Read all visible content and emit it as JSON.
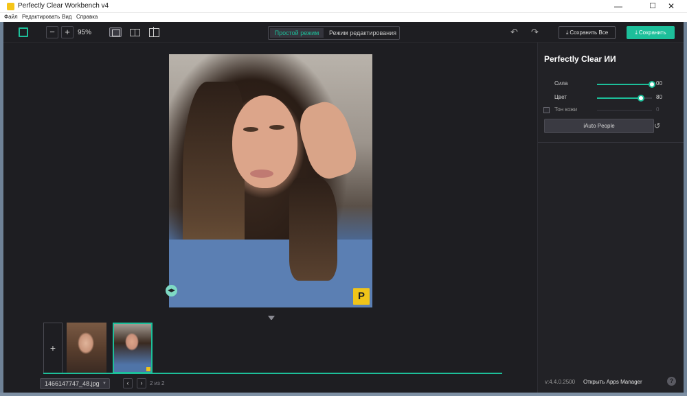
{
  "window": {
    "title": "Perfectly Clear Workbench v4",
    "minimize": "—",
    "maximize": "☐",
    "close": "✕"
  },
  "menu": {
    "items": [
      "Файл",
      "Редактировать",
      "Вид",
      "Справка"
    ]
  },
  "toolbar": {
    "zoom_out": "−",
    "zoom_in": "+",
    "zoom_level": "95%",
    "mode_simple": "Простой режим",
    "mode_edit": "Режим редактирования",
    "undo": "↶",
    "redo": "↷",
    "save_all": "Сохранить Все",
    "save": "Сохранить",
    "download_glyph": "⤓"
  },
  "canvas": {
    "badge": "P",
    "compare_handle": "◀▶"
  },
  "filmstrip": {
    "add": "+",
    "thumbnails": [
      "thumbnail-1",
      "thumbnail-2"
    ],
    "selected_index": 1
  },
  "status": {
    "filename": "1466147747_48.jpg",
    "caret": "▼",
    "prev": "‹",
    "next": "›",
    "page": "2 из 2"
  },
  "panel": {
    "title": "Perfectly Clear ИИ",
    "sliders": [
      {
        "label": "Сила",
        "value": "00",
        "level": 1.0,
        "enabled": true
      },
      {
        "label": "Цвет",
        "value": "80",
        "level": 0.8,
        "enabled": true
      },
      {
        "label": "Тон кожи",
        "value": "0",
        "level": 0,
        "enabled": false
      }
    ],
    "preset": "iAuto People",
    "reset": "↺",
    "version": "v:4.4.0.2500",
    "apps_manager": "Открыть Apps Manager",
    "help": "?"
  },
  "colors": {
    "accent": "#1dbf9a",
    "background": "#1e1e22",
    "panel": "#222226",
    "badge": "#f0c419"
  }
}
